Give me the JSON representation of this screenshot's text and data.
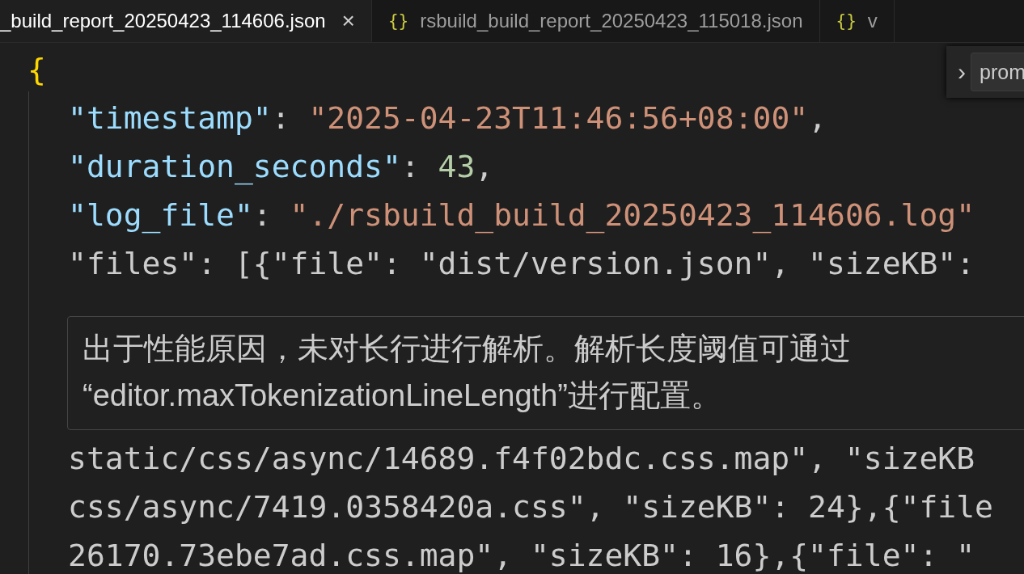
{
  "tabs": [
    {
      "label": "_build_report_20250423_114606.json",
      "selected": true,
      "close": "×"
    },
    {
      "label": "rsbuild_build_report_20250423_115018.json",
      "selected": false,
      "icon": "{}"
    },
    {
      "label": "v",
      "selected": false,
      "icon": "{}"
    }
  ],
  "find_widget": {
    "toggle": "›",
    "value": "prom"
  },
  "code_lines_above": [
    {
      "current": false,
      "tokens": [
        {
          "text": "{",
          "kind": "brace"
        }
      ]
    },
    {
      "current": false,
      "tokens": [
        {
          "text": "\"timestamp\"",
          "kind": "key"
        },
        {
          "text": ": ",
          "kind": "punct"
        },
        {
          "text": "\"2025-04-23T11:46:56+08:00\"",
          "kind": "string"
        },
        {
          "text": ",",
          "kind": "punct"
        }
      ]
    },
    {
      "current": false,
      "tokens": [
        {
          "text": "\"duration_seconds\"",
          "kind": "key"
        },
        {
          "text": ": ",
          "kind": "punct"
        },
        {
          "text": "43",
          "kind": "number"
        },
        {
          "text": ",",
          "kind": "punct"
        }
      ]
    },
    {
      "current": false,
      "tokens": [
        {
          "text": "\"log_file\"",
          "kind": "key"
        },
        {
          "text": ": ",
          "kind": "punct"
        },
        {
          "text": "\"./rsbuild_build_20250423_114606.log\"",
          "kind": "string"
        }
      ]
    },
    {
      "current": false,
      "tokens": [
        {
          "text": "\"files\": [{\"file\": \"dist/version.json\", \"sizeKB\":",
          "kind": "plain"
        }
      ]
    }
  ],
  "hover": {
    "message": "出于性能原因，未对长行进行解析。解析长度阈值可通过“editor.maxTokenizationLineLength”进行配置。"
  },
  "code_lines_below": [
    {
      "current": false,
      "tokens": [
        {
          "text": "static/css/async/14689.f4f02bdc.css.map\", \"sizeKB",
          "kind": "plain"
        }
      ]
    },
    {
      "current": false,
      "tokens": [
        {
          "text": "css/async/7419.0358420a.css\", \"sizeKB\": 24},{\"file",
          "kind": "plain"
        }
      ]
    },
    {
      "current": false,
      "tokens": [
        {
          "text": "26170.73ebe7ad.css.map\", \"sizeKB\": 16},{\"file\": \"",
          "kind": "plain"
        }
      ]
    }
  ]
}
